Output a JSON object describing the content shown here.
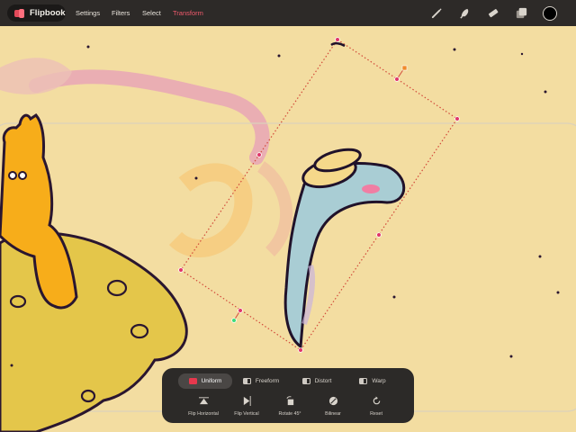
{
  "app": {
    "name": "Flipbook",
    "brand_color": "#e24a5a"
  },
  "menu": {
    "items": [
      {
        "id": "settings",
        "label": "Settings"
      },
      {
        "id": "filters",
        "label": "Filters"
      },
      {
        "id": "select",
        "label": "Select"
      },
      {
        "id": "transform",
        "label": "Transform",
        "active": true
      }
    ],
    "active_color": "#f15a6c"
  },
  "tools": [
    {
      "icon": "brush-icon"
    },
    {
      "icon": "smudge-icon"
    },
    {
      "icon": "eraser-icon"
    },
    {
      "icon": "layers-icon"
    },
    {
      "icon": "color-swatch",
      "color": "#000000"
    }
  ],
  "transform_toolbar": {
    "modes": [
      {
        "label": "Uniform",
        "icon": "uniform-icon",
        "active": true
      },
      {
        "label": "Freeform",
        "icon": "freeform-icon"
      },
      {
        "label": "Distort",
        "icon": "distort-icon"
      },
      {
        "label": "Warp",
        "icon": "warp-icon"
      }
    ],
    "actions": [
      {
        "label": "Flip Horizontal",
        "icon": "flip-horizontal-icon"
      },
      {
        "label": "Flip Vertical",
        "icon": "flip-vertical-icon"
      },
      {
        "label": "Rotate 45°",
        "icon": "rotate-45-icon"
      },
      {
        "label": "Bilinear",
        "icon": "bilinear-icon"
      },
      {
        "label": "Reset",
        "icon": "reset-icon"
      }
    ]
  },
  "colors": {
    "canvas": "#f3dda1",
    "bar": "#2d2a28",
    "handle": "#e0356a",
    "selection": "#d24a3a"
  }
}
